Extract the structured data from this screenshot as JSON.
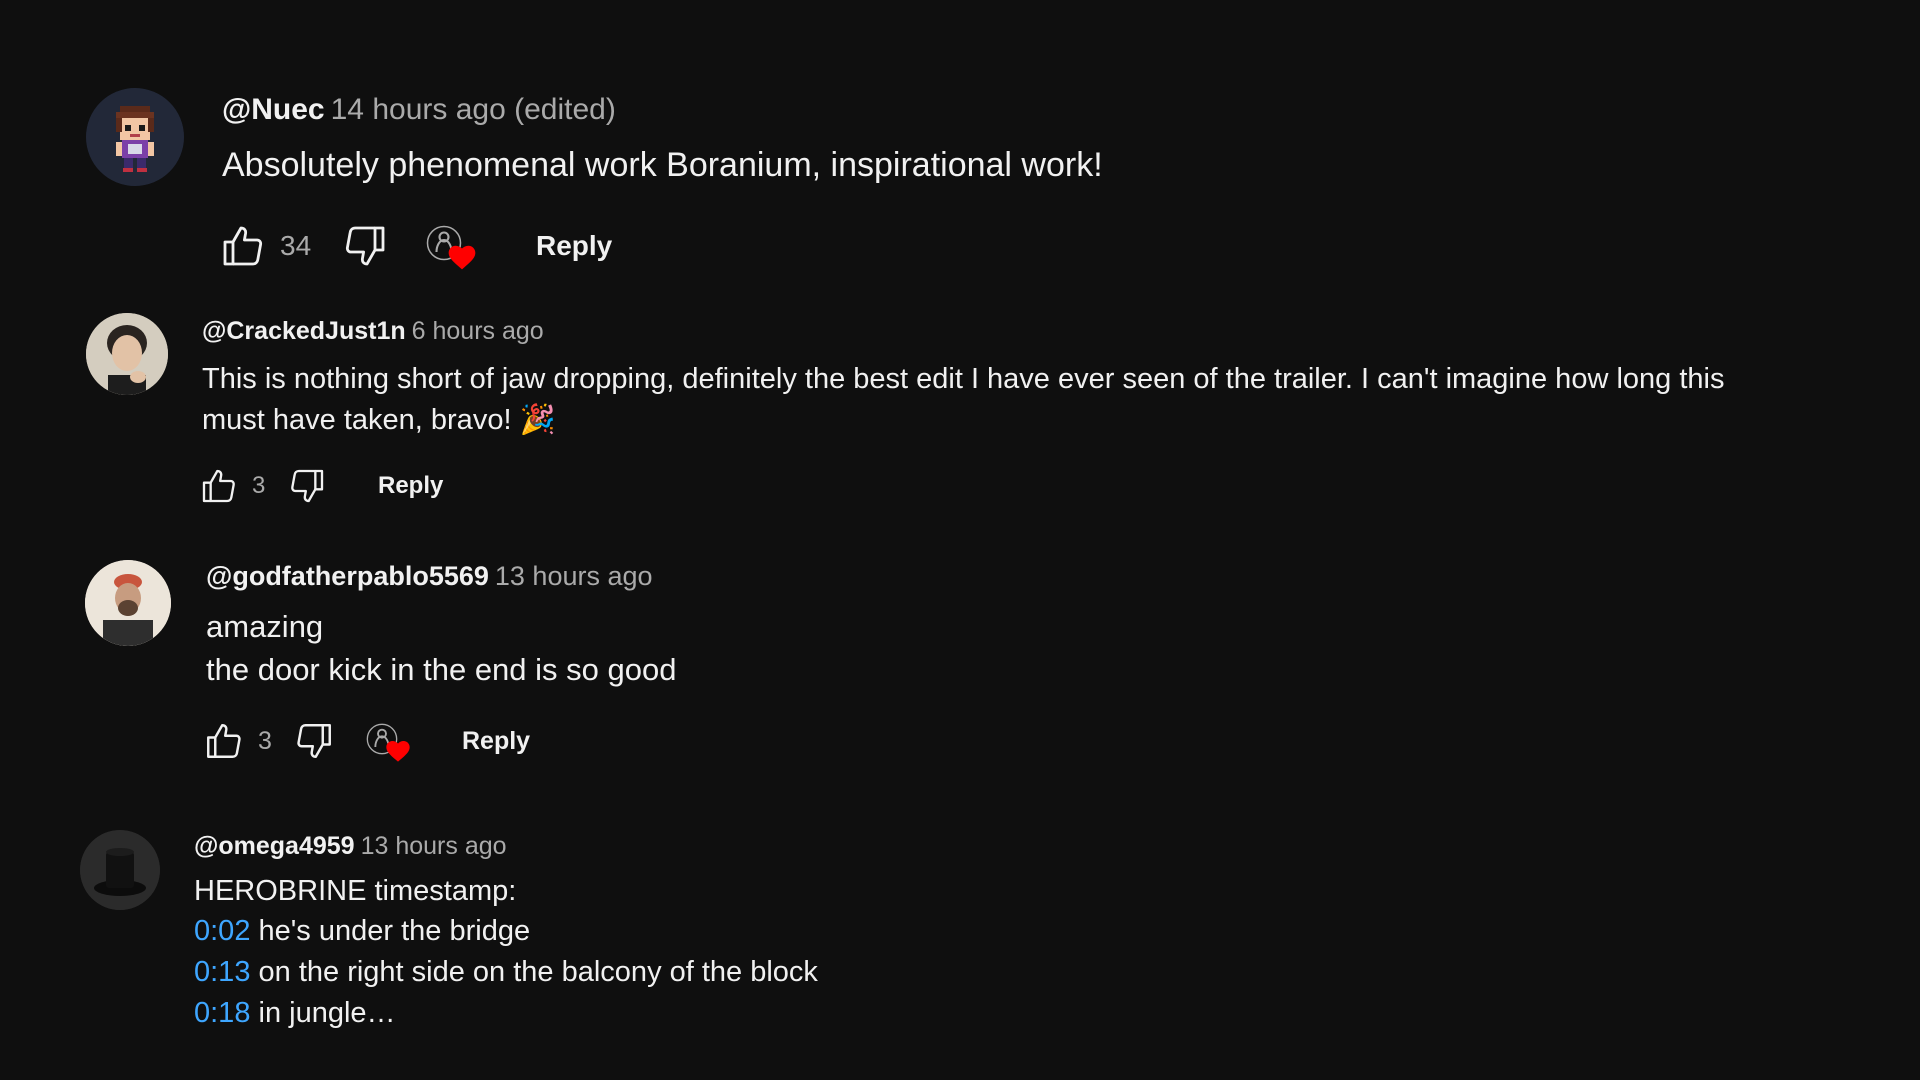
{
  "comments": [
    {
      "author": "@Nuec",
      "time": "14 hours ago (edited)",
      "lines": [
        {
          "text": "Absolutely phenomenal work Boranium, inspirational work!"
        }
      ],
      "likes": "34",
      "hearted": true,
      "reply_label": "Reply"
    },
    {
      "author": "@CrackedJust1n",
      "time": "6 hours ago",
      "lines": [
        {
          "text": "This is nothing short of jaw dropping, definitely the best edit I have ever seen of the trailer. I can't imagine how long this"
        },
        {
          "text": "must have taken, bravo! 🎉"
        }
      ],
      "likes": "3",
      "hearted": false,
      "reply_label": "Reply"
    },
    {
      "author": "@godfatherpablo5569",
      "time": "13 hours ago",
      "lines": [
        {
          "text": "amazing"
        },
        {
          "text": "the door kick in the end is so good"
        }
      ],
      "likes": "3",
      "hearted": true,
      "reply_label": "Reply"
    },
    {
      "author": "@omega4959",
      "time": "13 hours ago",
      "lines": [
        {
          "text": "HEROBRINE timestamp:"
        },
        {
          "timestamp": "0:02",
          "text": " he's under the bridge"
        },
        {
          "timestamp": "0:13",
          "text": " on the right side on the balcony of the block"
        },
        {
          "timestamp": "0:18",
          "text": " in jungle…"
        }
      ]
    }
  ],
  "colors": {
    "background": "#0f0f0f",
    "text": "#f1f1f1",
    "secondary": "#aaaaaa",
    "link": "#3ea6ff",
    "heart": "#ff0000"
  }
}
